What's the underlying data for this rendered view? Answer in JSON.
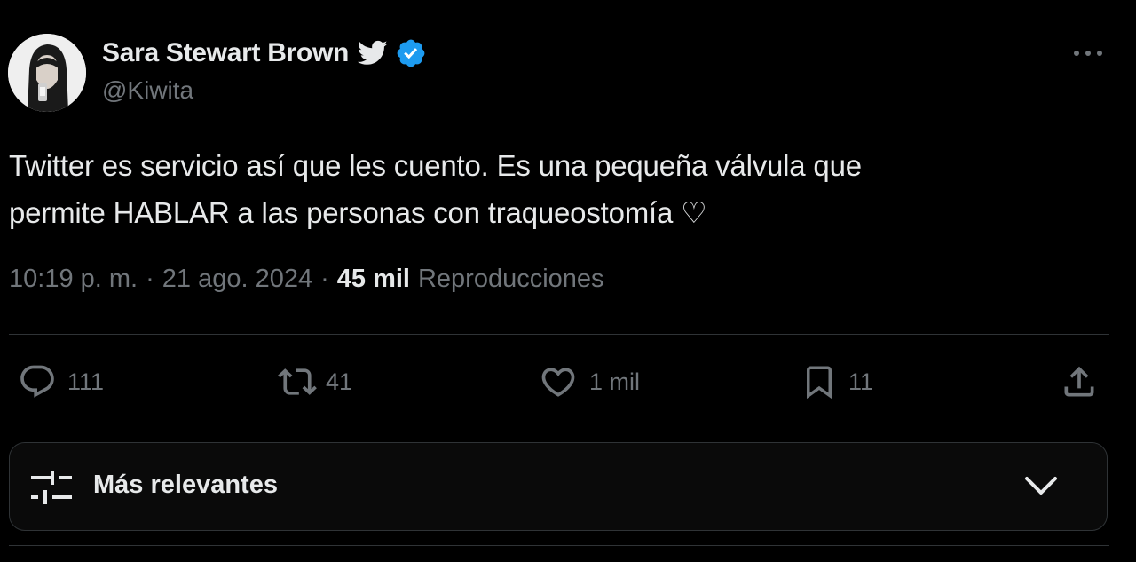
{
  "author": {
    "display_name": "Sara Stewart Brown",
    "handle": "@Kiwita",
    "bird_icon": "twitter-bird-icon",
    "verified_icon": "verified-badge-icon",
    "verified_color": "#1d9bf0"
  },
  "tweet": {
    "line1": "Twitter es servicio así que les cuento. Es una pequeña válvula que",
    "line2": "permite HABLAR a las personas con traqueostomía ♡"
  },
  "meta": {
    "time": "10:19 p. m.",
    "separator": "·",
    "date": "21 ago. 2024",
    "views_count": "45 mil",
    "views_label": "Reproducciones"
  },
  "actions": {
    "replies": {
      "icon": "reply-icon",
      "count": "111"
    },
    "retweets": {
      "icon": "retweet-icon",
      "count": "41"
    },
    "likes": {
      "icon": "heart-icon",
      "count": "1 mil"
    },
    "bookmarks": {
      "icon": "bookmark-icon",
      "count": "11"
    },
    "share": {
      "icon": "share-icon"
    }
  },
  "more": {
    "icon": "more-dots-icon"
  },
  "sort": {
    "icon": "sliders-icon",
    "label": "Más relevantes",
    "chevron_icon": "chevron-down-icon"
  },
  "colors": {
    "background": "#000000",
    "primary_text": "#e7e9ea",
    "secondary_text": "#71767b",
    "divider": "#2f3336"
  }
}
